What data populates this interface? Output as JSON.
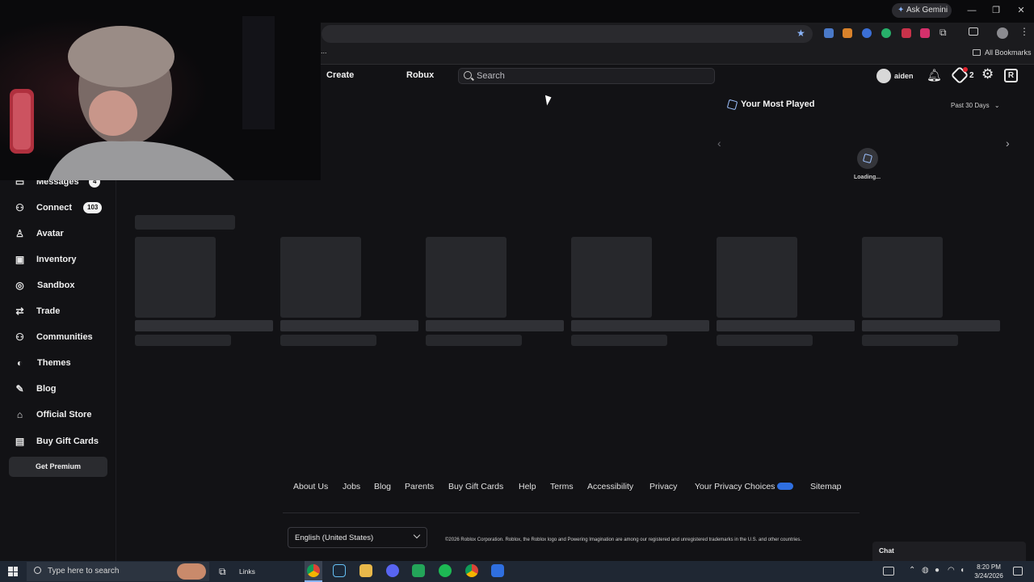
{
  "browser": {
    "gemini_label": "Ask Gemini",
    "bookmarks_label": "All Bookmarks",
    "bookmark_ellipsis": "..."
  },
  "header": {
    "nav": [
      "Create",
      "Robux"
    ],
    "search_placeholder": "Search",
    "username": "aiden",
    "robux_count": "2"
  },
  "sidebar": {
    "items": [
      {
        "label": "Messages",
        "icon": "chat-bubble-icon",
        "badge": "4"
      },
      {
        "label": "Connect",
        "icon": "people-icon",
        "badge": "103"
      },
      {
        "label": "Avatar",
        "icon": "avatar-figure-icon"
      },
      {
        "label": "Inventory",
        "icon": "inventory-bag-icon"
      },
      {
        "label": "Sandbox",
        "icon": "sandbox-icon"
      },
      {
        "label": "Trade",
        "icon": "trade-arrows-icon"
      },
      {
        "label": "Communities",
        "icon": "communities-icon"
      },
      {
        "label": "Themes",
        "icon": "themes-icon"
      },
      {
        "label": "Blog",
        "icon": "pen-icon"
      },
      {
        "label": "Official Store",
        "icon": "store-icon"
      },
      {
        "label": "Buy Gift Cards",
        "icon": "gift-card-icon"
      }
    ],
    "premium_label": "Get Premium"
  },
  "most_played": {
    "title": "Your Most Played",
    "range": "Past 30 Days",
    "loading_text": "Loading..."
  },
  "footer": {
    "links": [
      "About Us",
      "Jobs",
      "Blog",
      "Parents",
      "Buy Gift Cards",
      "Help",
      "Terms",
      "Accessibility",
      "Privacy",
      "Your Privacy Choices",
      "Sitemap"
    ],
    "language": "English (United States)",
    "copyright": "©2026 Roblox Corporation. Roblox, the Roblox logo and Powering Imagination are among our registered and unregistered trademarks in the U.S. and other countries."
  },
  "chat": {
    "label": "Chat"
  },
  "taskbar": {
    "search_placeholder": "Type here to search",
    "links_label": "Links",
    "time": "8:20 PM",
    "date": "3/24/2026"
  },
  "colors": {
    "page_bg": "#121215",
    "skeleton": "#27282c",
    "accent_red": "#e0242f"
  }
}
